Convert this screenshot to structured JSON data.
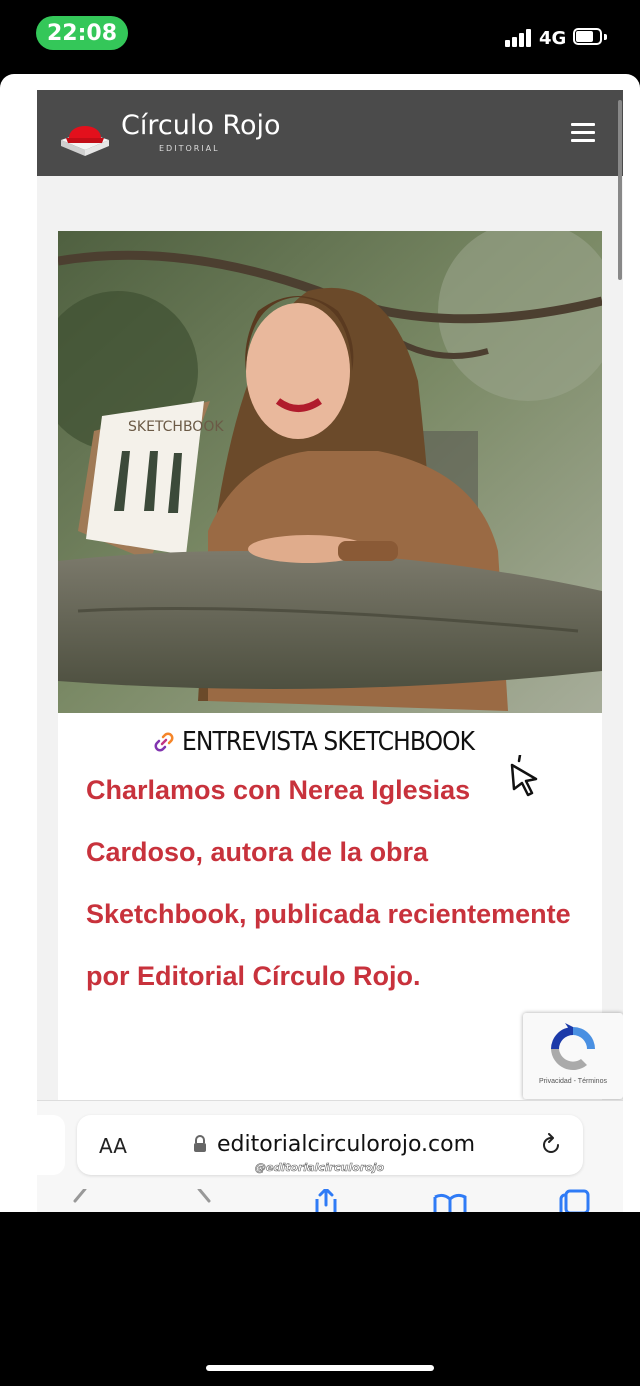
{
  "status_bar": {
    "time": "22:08",
    "network": "4G",
    "accent_color": "#34c759"
  },
  "site": {
    "brand_name": "Círculo Rojo",
    "brand_sub": "EDITORIAL",
    "header_color": "#4b4b4b",
    "logo_color": "#e3101c",
    "menu_icon": "hamburger-icon"
  },
  "promo": {
    "heading": "ENTREVISTA SKETCHBOOK",
    "link_icon": "link-icon",
    "cursor_icon": "cursor-click-icon",
    "book_label": "SKETCHBOOK",
    "text": "Charlamos con Nerea Iglesias Cardoso, autora de la obra Sketchbook, publicada recientemente por Editorial Círculo Rojo.",
    "text_color": "#c8323c"
  },
  "recaptcha": {
    "label": "Privacidad - Términos"
  },
  "browser": {
    "aa_label": "AA",
    "url": "editorialcirculorojo.com",
    "watermark": "@editorialcirculorojo",
    "lock_icon": "lock-icon",
    "reload_icon": "reload-icon"
  }
}
